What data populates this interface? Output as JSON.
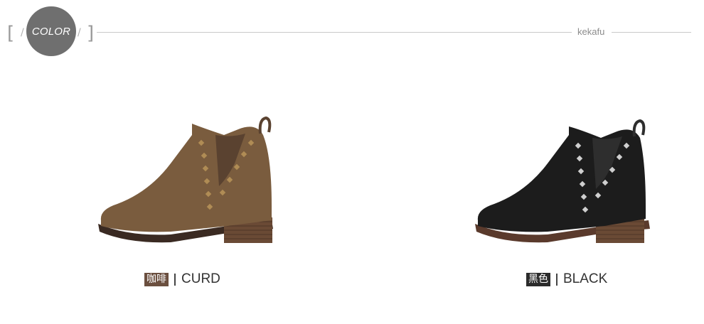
{
  "header": {
    "left_bracket": "[",
    "right_bracket": "]",
    "slash": "/",
    "badge_label": "COLOR",
    "brand": "kekafu"
  },
  "products": [
    {
      "cn_label": "咖啡",
      "en_label": "CURD",
      "tag_color": "#6b4f3f",
      "boot_color": "#7a5c3e"
    },
    {
      "cn_label": "黑色",
      "en_label": "BLACK",
      "tag_color": "#2b2b2b",
      "boot_color": "#1c1c1c"
    }
  ]
}
